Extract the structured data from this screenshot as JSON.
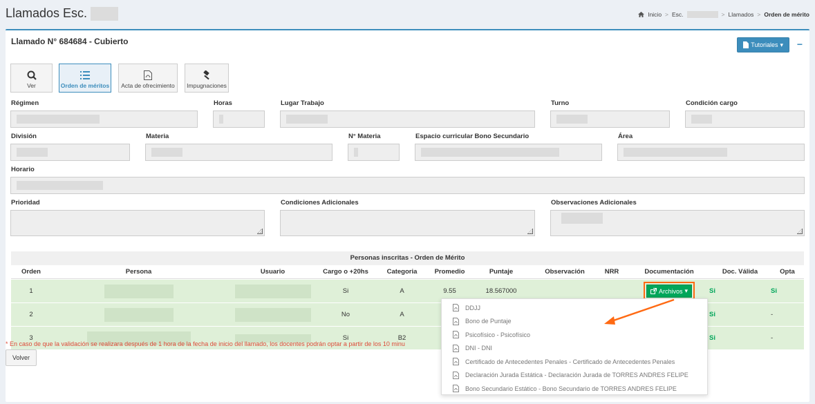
{
  "page": {
    "title": "Llamados Esc."
  },
  "breadcrumb": {
    "home": "Inicio",
    "school": "Esc.",
    "llamados": "Llamados",
    "current": "Orden de mérito"
  },
  "box": {
    "title": "Llamado N° 684684 - Cubierto",
    "tutoriales": "Tutoriales",
    "collapse": "−"
  },
  "toolbar": {
    "ver": "Ver",
    "orden": "Orden de méritos",
    "acta": "Acta de ofrecimiento",
    "impugnaciones": "Impugnaciones"
  },
  "fields": {
    "regimen": "Régimen",
    "horas": "Horas",
    "lugar": "Lugar Trabajo",
    "turno": "Turno",
    "condicion": "Condición cargo",
    "division": "División",
    "materia": "Materia",
    "nmateria": "N° Materia",
    "espacio": "Espacio curricular Bono Secundario",
    "area": "Área",
    "horario": "Horario",
    "prioridad": "Prioridad",
    "condiciones": "Condiciones Adicionales",
    "observaciones": "Observaciones Adicionales"
  },
  "table": {
    "title": "Personas inscritas - Orden de Mérito",
    "headers": [
      "Orden",
      "Persona",
      "Usuario",
      "Cargo o +20hs",
      "Categoria",
      "Promedio",
      "Puntaje",
      "Observación",
      "NRR",
      "Documentación",
      "Doc. Válida",
      "Opta"
    ],
    "rows": [
      {
        "orden": "1",
        "cargo": "Si",
        "categoria": "A",
        "promedio": "9.55",
        "puntaje": "18.567000",
        "valida": "Si",
        "opta": "Si"
      },
      {
        "orden": "2",
        "cargo": "No",
        "categoria": "A",
        "promedio": "",
        "puntaje": "",
        "valida": "Si",
        "opta": "-"
      },
      {
        "orden": "3",
        "cargo": "Si",
        "categoria": "B2",
        "promedio": "",
        "puntaje": "",
        "valida": "Si",
        "opta": "-"
      }
    ],
    "archivos": "Archivos"
  },
  "dropdown": [
    "DDJJ",
    "Bono de Puntaje",
    "Psicofísico - Psicofísico",
    "DNI - DNI",
    "Certificado de Antecedentes Penales - Certificado de Antecedentes Penales",
    "Declaración Jurada Estática - Declaración Jurada de TORRES ANDRES FELIPE",
    "Bono Secundario Estático - Bono Secundario de TORRES ANDRES FELIPE"
  ],
  "footnote": "* En caso de que la validación se realizara después de 1 hora de la fecha de inicio del llamado, los docentes podrán optar a partir de los 10 minu",
  "volver": "Volver",
  "colors": {
    "accent": "#3c8dbc",
    "success": "#00a65a",
    "row_bg": "#dff0d8",
    "highlight": "#ff6a13"
  }
}
